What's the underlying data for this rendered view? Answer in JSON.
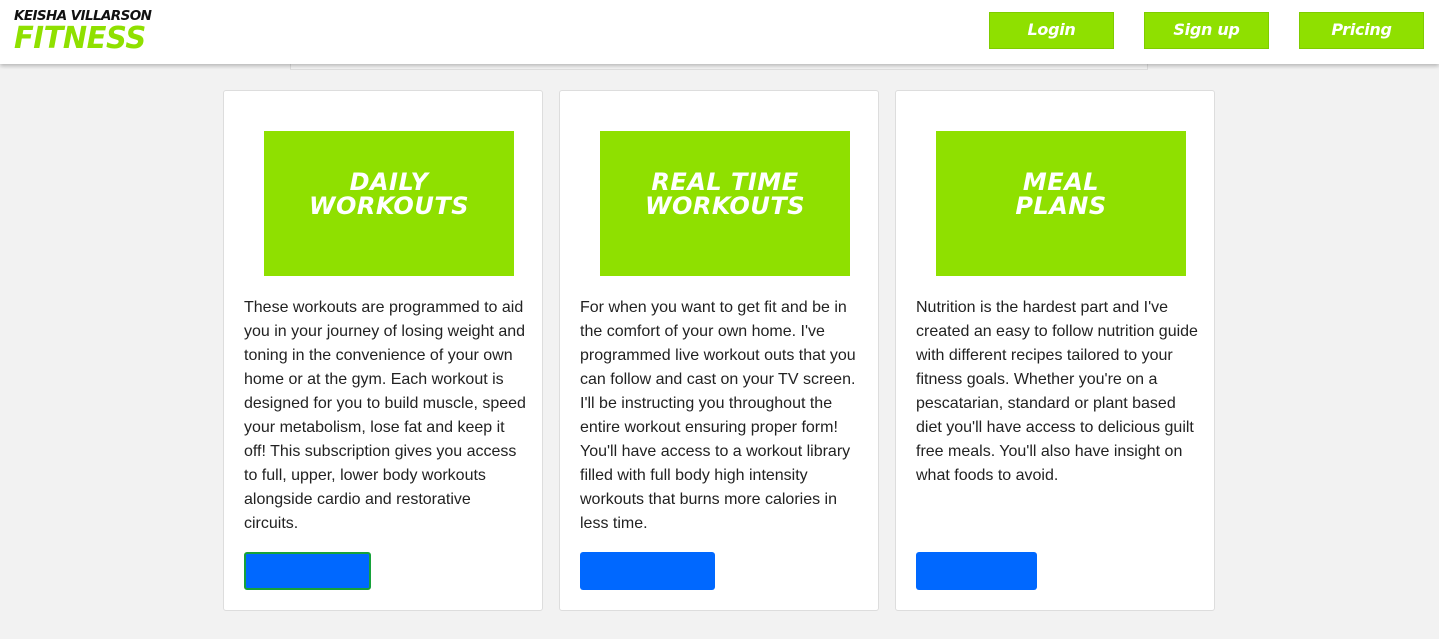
{
  "header": {
    "logo_top": "KEISHA VILLARSON",
    "logo_bottom": "FITNESS",
    "nav": {
      "login": "Login",
      "signup": "Sign up",
      "pricing": "Pricing"
    }
  },
  "cards": [
    {
      "title_lines": [
        "DAILY",
        "WORKOUTS"
      ],
      "description": "These workouts are programmed to aid you in your journey of losing weight and toning in the convenience of your own home or at the gym. Each workout is designed for you to build muscle, speed your metabolism, lose fat and keep it off! This subscription gives you access to full, upper, lower body workouts alongside cardio and restorative circuits.",
      "button_label": ""
    },
    {
      "title_lines": [
        "REAL TIME",
        "WORKOUTS"
      ],
      "description": "For when you want to get fit and be in the comfort of your own home. I've programmed live workout outs that you can follow and cast on your TV screen. I'll be instructing you throughout the entire workout ensuring proper form! You'll have access to a workout library filled with full body high intensity workouts that burns more calories in less time.",
      "button_label": ""
    },
    {
      "title_lines": [
        "MEAL",
        "PLANS"
      ],
      "description": "Nutrition is the hardest part and I've created an easy to follow nutrition guide with different recipes tailored to your fitness goals. Whether you're on a pescatarian, standard or plant based diet you'll have access to delicious guilt free meals. You'll also have insight on what foods to avoid.",
      "button_label": ""
    }
  ],
  "colors": {
    "brand_green": "#8fe000",
    "button_blue": "#0068ff",
    "page_background": "#f2f2f2"
  }
}
